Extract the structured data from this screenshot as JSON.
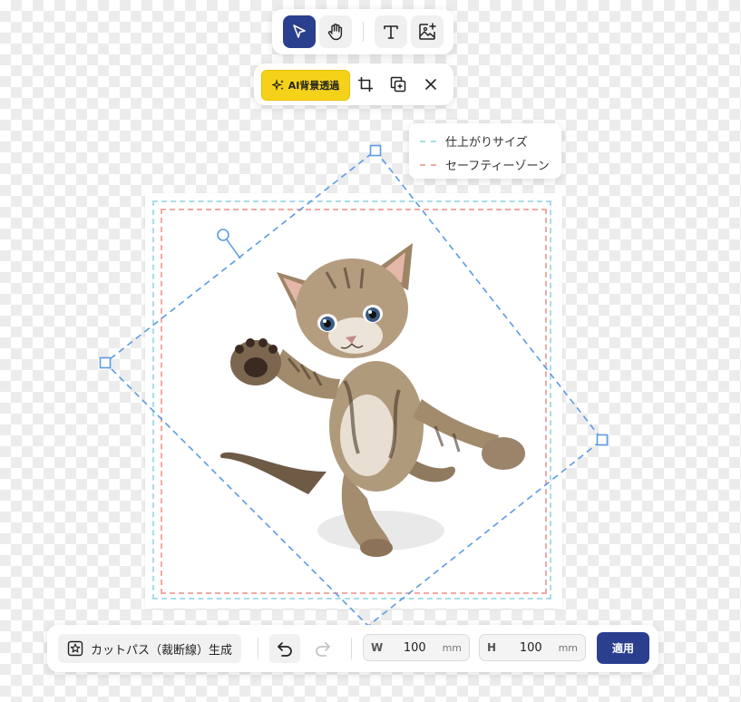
{
  "tool_toolbar": {
    "items": [
      {
        "name": "select-tool",
        "icon": "pointer-icon",
        "active": true
      },
      {
        "name": "hand-tool",
        "icon": "hand-icon",
        "active": false
      },
      {
        "name": "text-tool",
        "icon": "text-icon",
        "active": false
      },
      {
        "name": "add-image-tool",
        "icon": "image-plus-icon",
        "active": false
      }
    ]
  },
  "image_toolbar": {
    "ai_label": "AI背景透過",
    "ai_icon": "sparkle-icon",
    "actions": [
      "crop-icon",
      "duplicate-icon",
      "close-icon"
    ]
  },
  "legend": {
    "items": [
      {
        "label": "仕上がりサイズ",
        "color": "#a9dde8"
      },
      {
        "label": "セーフティーゾーン",
        "color": "#f2aaa3"
      }
    ]
  },
  "canvas": {
    "image": "cat-kitten-photo",
    "selection_color": "#5b9be6"
  },
  "bottom_bar": {
    "cutpath_label": "カットパス（裁断線）生成",
    "cutpath_icon": "star-square-icon",
    "undo_icon": "undo-icon",
    "redo_icon": "redo-icon",
    "width": {
      "label": "W",
      "value": "100",
      "unit": "mm"
    },
    "height": {
      "label": "H",
      "value": "100",
      "unit": "mm"
    },
    "apply_label": "適用"
  },
  "colors": {
    "accent": "#2b3f8f",
    "ai_yellow": "#f5d21a"
  }
}
